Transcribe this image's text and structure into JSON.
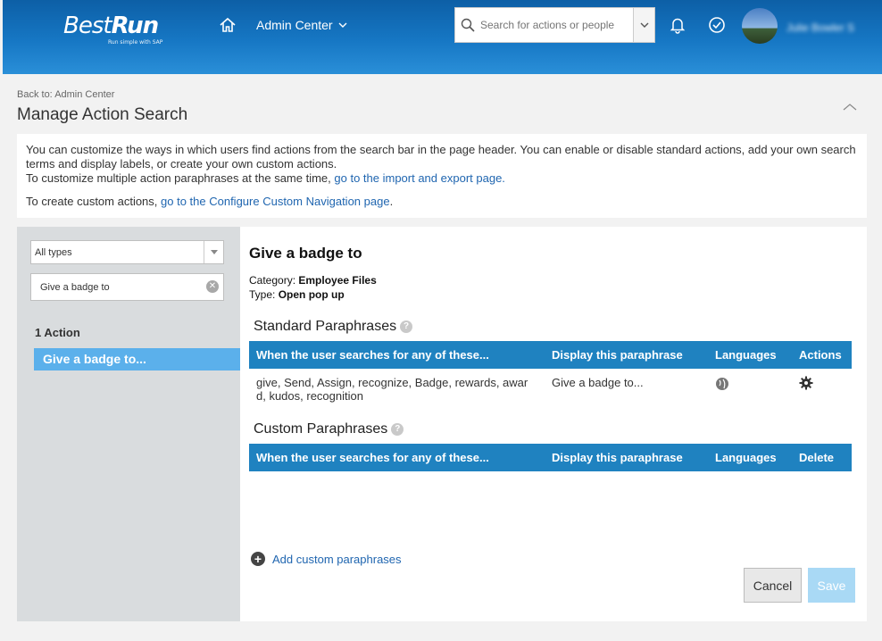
{
  "header": {
    "logo_main": "Best",
    "logo_bold": "Run",
    "logo_sub": "Run simple with SAP",
    "module_label": "Admin Center",
    "search_placeholder": "Search for actions or people",
    "user_name": "Julie Bowler S"
  },
  "page": {
    "back_link": "Back to: Admin Center",
    "title": "Manage Action Search"
  },
  "info": {
    "line1": "You can customize the ways in which users find actions from the search bar in the page header. You can enable or disable standard actions, add your own search terms and display labels, or create your own custom actions.",
    "line2_text": "To customize multiple action paraphrases at the same time, ",
    "line2_link": "go to the import and export page.",
    "line3_text": "To create custom actions, ",
    "line3_link": "go to the Configure Custom Navigation page",
    "line3_end": "."
  },
  "sidebar": {
    "type_filter": "All types",
    "filter_value": "Give a badge to",
    "count_label": "1 Action",
    "items": [
      {
        "label": "Give a badge to..."
      }
    ]
  },
  "detail": {
    "title": "Give a badge to",
    "category_label": "Category:",
    "category_value": "Employee Files",
    "type_label": "Type:",
    "type_value": "Open pop up",
    "standard_title": "Standard Paraphrases",
    "custom_title": "Custom Paraphrases",
    "standard_headers": [
      "When the user searches for any of these...",
      "Display this paraphrase",
      "Languages",
      "Actions"
    ],
    "custom_headers": [
      "When the user searches for any of these...",
      "Display this paraphrase",
      "Languages",
      "Delete"
    ],
    "standard_rows": [
      {
        "terms": "give, Send, Assign, recognize, Badge, rewards, award, kudos, recognition",
        "paraphrase": "Give a badge to..."
      }
    ],
    "add_label": "Add custom paraphrases",
    "cancel_label": "Cancel",
    "save_label": "Save"
  }
}
